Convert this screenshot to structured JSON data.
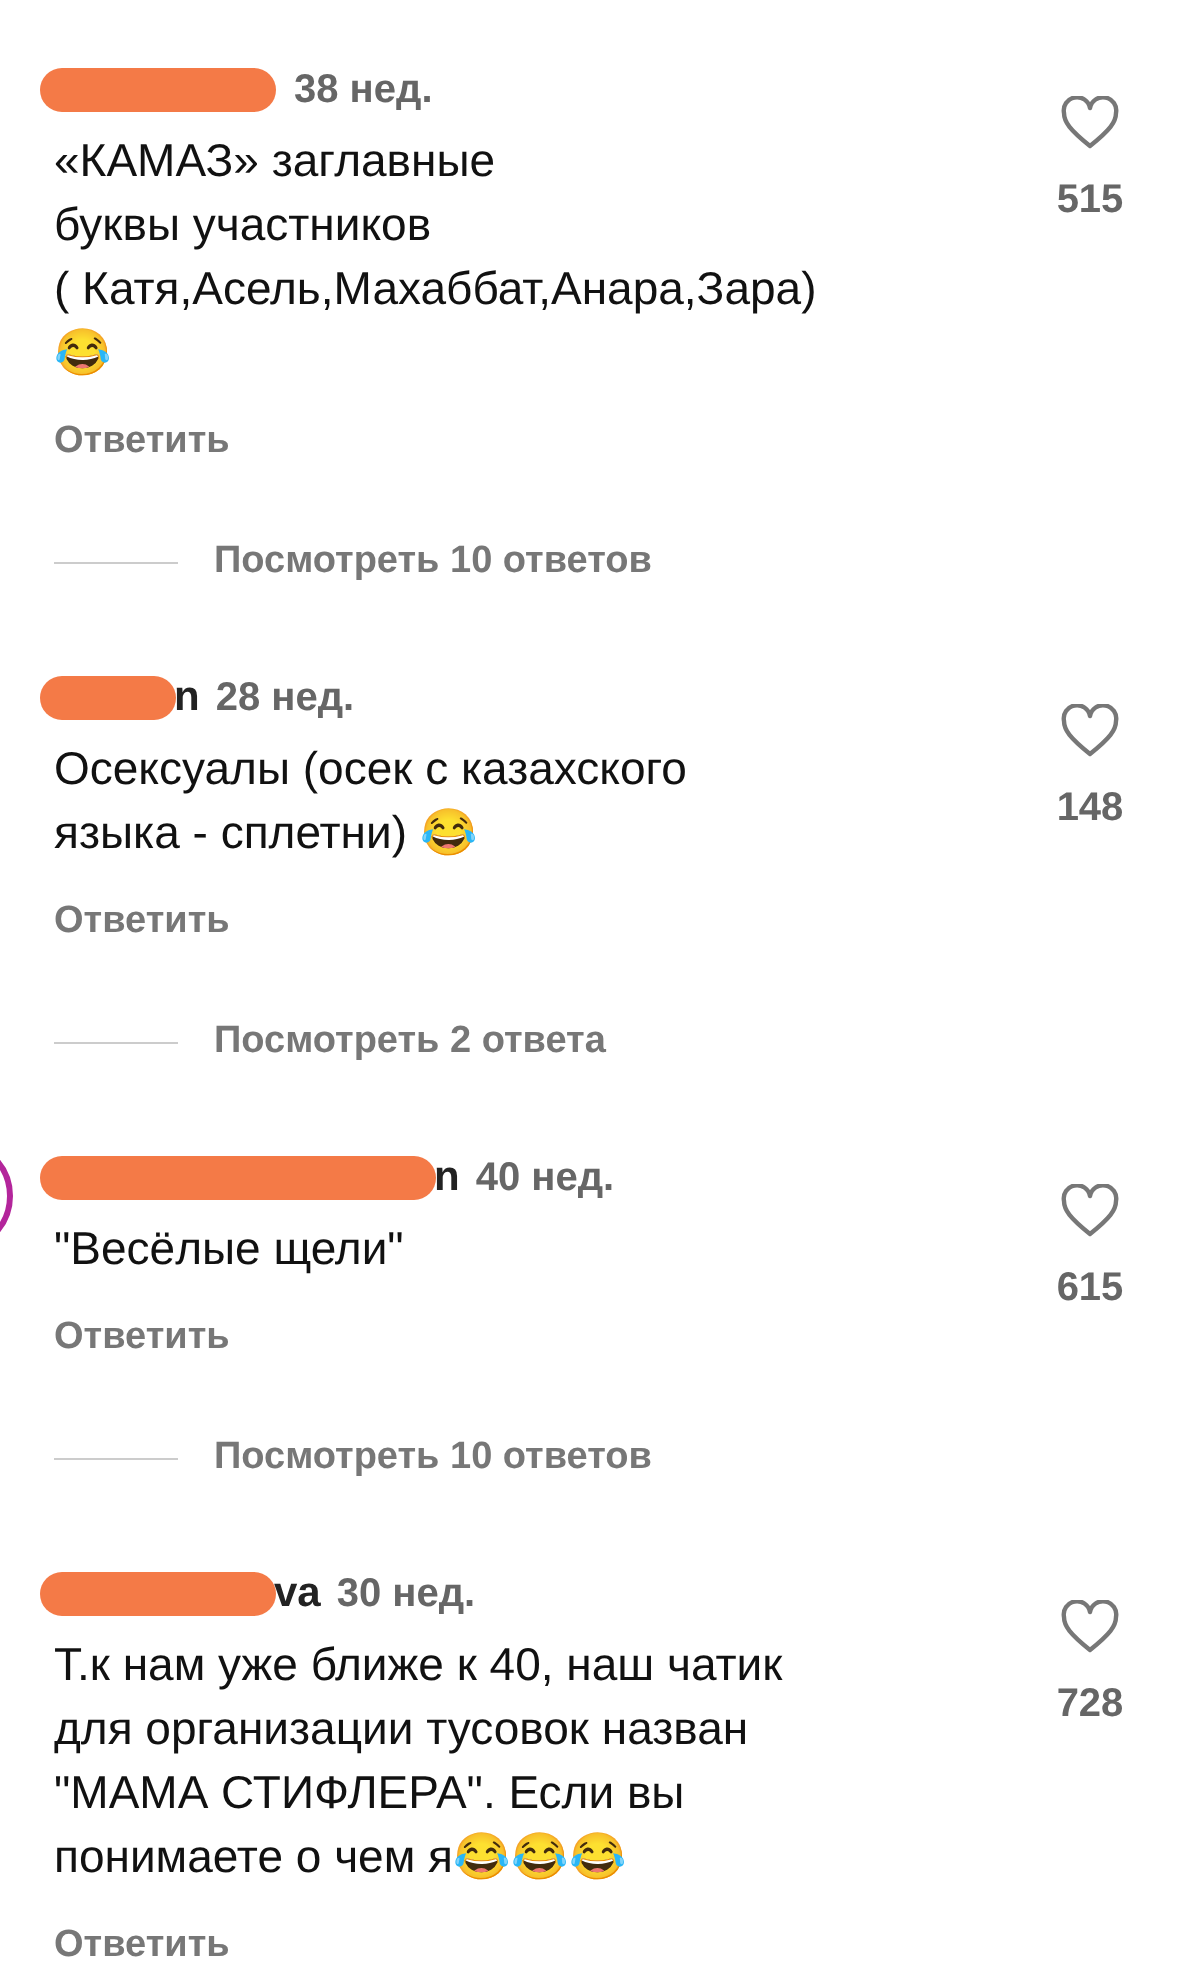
{
  "comments": [
    {
      "time": "38 нед.",
      "text": "«КАМАЗ» заглавные\nбуквы участников\n( Катя,Асель,Махаббат,Анара,Зара)\n😂",
      "likes": "515",
      "reply": "Ответить",
      "view_replies": "Посмотреть 10 ответов",
      "story_ring": false
    },
    {
      "username_visible": "n",
      "time": "28 нед.",
      "text": "Осексуалы (осек с казахского\nязыка - сплетни) 😂",
      "likes": "148",
      "reply": "Ответить",
      "view_replies": "Посмотреть 2 ответа",
      "story_ring": false
    },
    {
      "username_visible": "n",
      "time": "40 нед.",
      "text": "\"Весёлые щели\"",
      "likes": "615",
      "reply": "Ответить",
      "view_replies": "Посмотреть 10 ответов",
      "story_ring": true
    },
    {
      "username_visible": "va",
      "time": "30 нед.",
      "text": "Т.к нам уже ближе к 40, наш чатик\nдля организации тусовок назван\n\"МАМА СТИФЛЕРА\". Если вы\nпонимаете о чем я😂😂😂",
      "likes": "728",
      "reply": "Ответить",
      "story_ring": false
    }
  ]
}
